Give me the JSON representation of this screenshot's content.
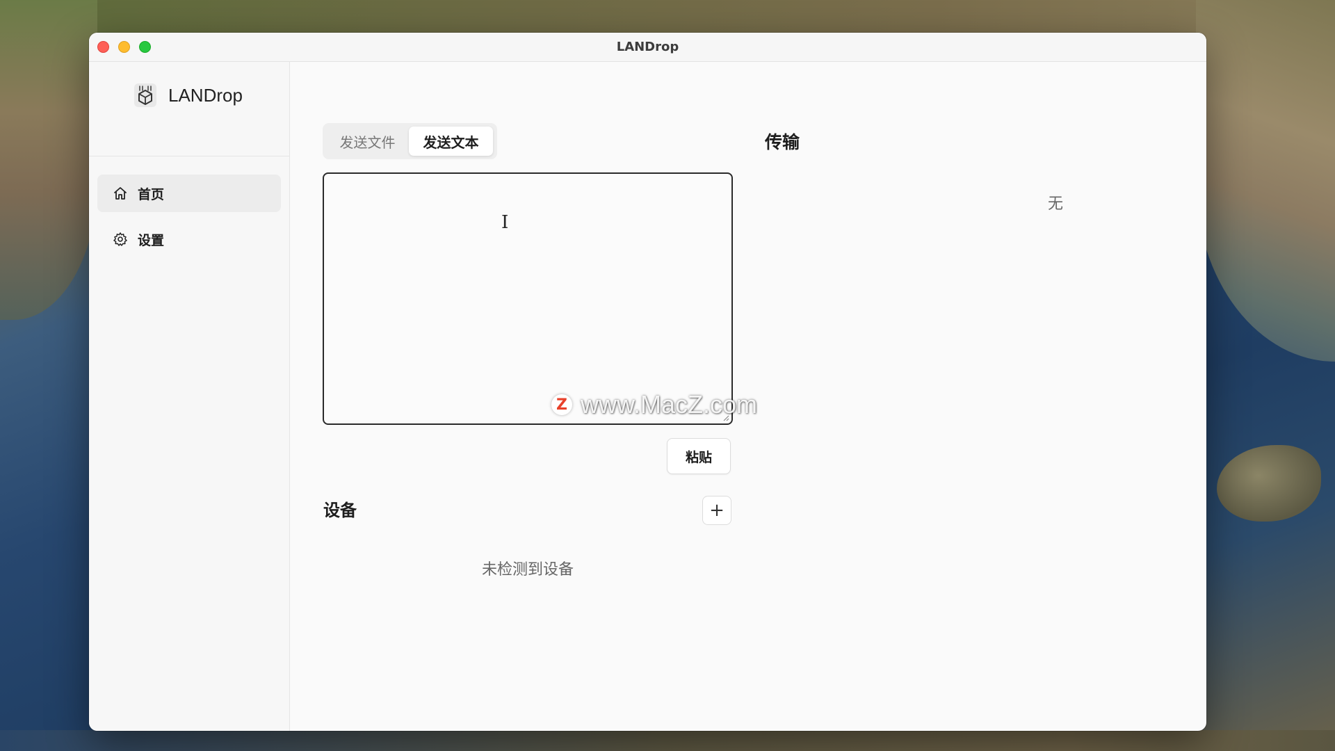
{
  "window": {
    "title": "LANDrop"
  },
  "sidebar": {
    "brand": "LANDrop",
    "items": [
      {
        "label": "首页",
        "icon": "home-icon",
        "active": true
      },
      {
        "label": "设置",
        "icon": "gear-icon",
        "active": false
      }
    ]
  },
  "send": {
    "tabs": [
      {
        "label": "发送文件",
        "selected": false
      },
      {
        "label": "发送文本",
        "selected": true
      }
    ],
    "text_value": "",
    "paste_label": "粘贴"
  },
  "devices": {
    "title": "设备",
    "add_label": "+",
    "empty_text": "未检测到设备"
  },
  "transfer": {
    "title": "传输",
    "empty_text": "无"
  },
  "watermark": {
    "badge": "Z",
    "text": "www.MacZ.com"
  },
  "colors": {
    "close": "#fe5f57",
    "minimize": "#febc2e",
    "maximize": "#28c840",
    "watermark_badge": "#e8412b"
  }
}
